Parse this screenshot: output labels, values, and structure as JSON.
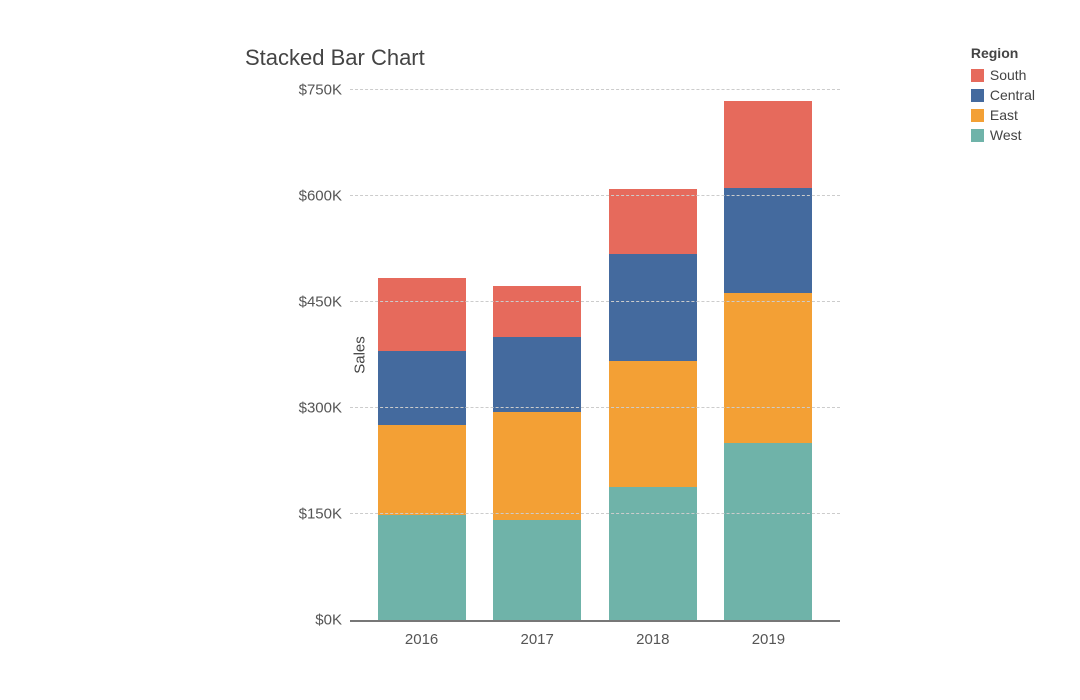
{
  "chart_data": {
    "type": "bar",
    "stacked": true,
    "title": "Stacked Bar Chart",
    "ylabel": "Sales",
    "xlabel": "",
    "categories": [
      "2016",
      "2017",
      "2018",
      "2019"
    ],
    "series": [
      {
        "name": "West",
        "color": "#6fb3a9",
        "values": [
          148000,
          142000,
          188000,
          250000
        ]
      },
      {
        "name": "East",
        "color": "#f3a035",
        "values": [
          128000,
          153000,
          178000,
          213000
        ]
      },
      {
        "name": "Central",
        "color": "#446a9e",
        "values": [
          105000,
          106000,
          152000,
          148000
        ]
      },
      {
        "name": "South",
        "color": "#e66a5c",
        "values": [
          103000,
          72000,
          92000,
          123000
        ]
      }
    ],
    "legend": {
      "title": "Region",
      "order": [
        "South",
        "Central",
        "East",
        "West"
      ]
    },
    "yticks": [
      0,
      150000,
      300000,
      450000,
      600000,
      750000
    ],
    "ytick_labels": [
      "$0K",
      "$150K",
      "$300K",
      "$450K",
      "$600K",
      "$750K"
    ],
    "ylim": [
      0,
      750000
    ]
  }
}
